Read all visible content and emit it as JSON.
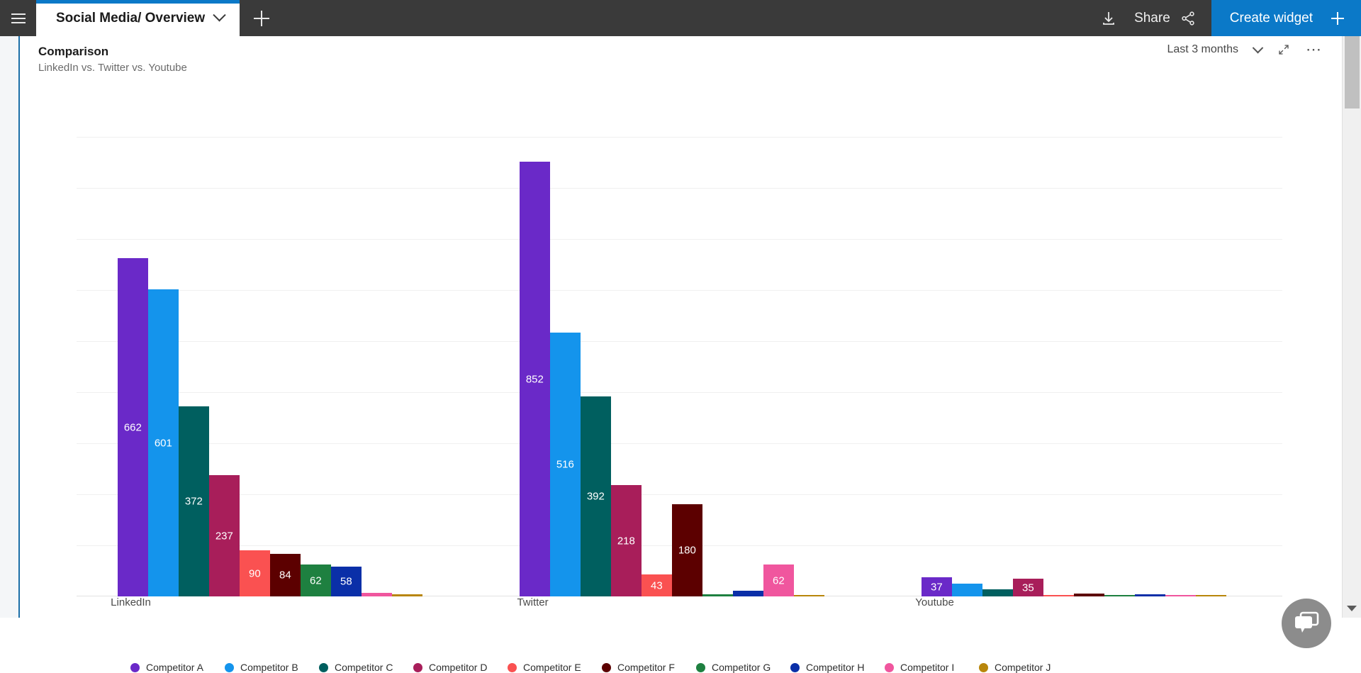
{
  "topbar": {
    "menu_icon": "hamburger-menu-icon",
    "tab_title": "Social Media/ Overview",
    "tab_chevron_icon": "chevron-down-icon",
    "new_tab_icon": "plus-icon",
    "download_icon": "download-icon",
    "share_label": "Share",
    "share_icon": "share-nodes-icon",
    "create_widget_label": "Create widget",
    "create_widget_icon": "plus-icon"
  },
  "widget": {
    "title": "Comparison",
    "subtitle": "LinkedIn vs. Twitter vs. Youtube",
    "date_range": "Last 3 months",
    "date_range_chevron_icon": "chevron-down-icon",
    "expand_icon": "expand-arrows-icon",
    "more_icon": "ellipsis-icon"
  },
  "chat": {
    "icon": "chat-bubbles-icon"
  },
  "scrollbar": {
    "down_arrow_icon": "caret-down-icon"
  },
  "chart_data": {
    "type": "bar",
    "title": "Comparison",
    "subtitle": "LinkedIn vs. Twitter vs. Youtube",
    "xlabel": "",
    "ylabel": "",
    "grid": true,
    "legend_position": "bottom",
    "ylim": [
      0,
      900
    ],
    "categories": [
      "LinkedIn",
      "Twitter",
      "Youtube"
    ],
    "series": [
      {
        "name": "Competitor A",
        "color": "#6A29C8",
        "values": [
          662,
          852,
          37
        ]
      },
      {
        "name": "Competitor B",
        "color": "#1494EC",
        "values": [
          601,
          516,
          25
        ]
      },
      {
        "name": "Competitor C",
        "color": "#005F5F",
        "values": [
          372,
          392,
          14
        ]
      },
      {
        "name": "Competitor D",
        "color": "#A81E5A",
        "values": [
          237,
          218,
          35
        ]
      },
      {
        "name": "Competitor E",
        "color": "#FA5151",
        "values": [
          90,
          43,
          1
        ]
      },
      {
        "name": "Competitor F",
        "color": "#5C0000",
        "values": [
          84,
          180,
          5
        ]
      },
      {
        "name": "Competitor G",
        "color": "#1E8040",
        "values": [
          62,
          4,
          0
        ]
      },
      {
        "name": "Competitor H",
        "color": "#0A2FA8",
        "values": [
          58,
          11,
          4
        ]
      },
      {
        "name": "Competitor I",
        "color": "#F0569E",
        "values": [
          7,
          62,
          1
        ]
      },
      {
        "name": "Competitor J",
        "color": "#B8860B",
        "values": [
          4,
          1,
          0
        ]
      }
    ],
    "data_labels": {
      "LinkedIn": [
        "662",
        "601",
        "372",
        "237",
        "90",
        "84",
        "62",
        "58",
        "",
        ""
      ],
      "Twitter": [
        "852",
        "516",
        "392",
        "218",
        "43",
        "180",
        "",
        "",
        "62",
        ""
      ],
      "Youtube": [
        "37",
        "",
        "",
        "35",
        "",
        "",
        "",
        "",
        "",
        ""
      ]
    },
    "gridline_count": 9
  }
}
